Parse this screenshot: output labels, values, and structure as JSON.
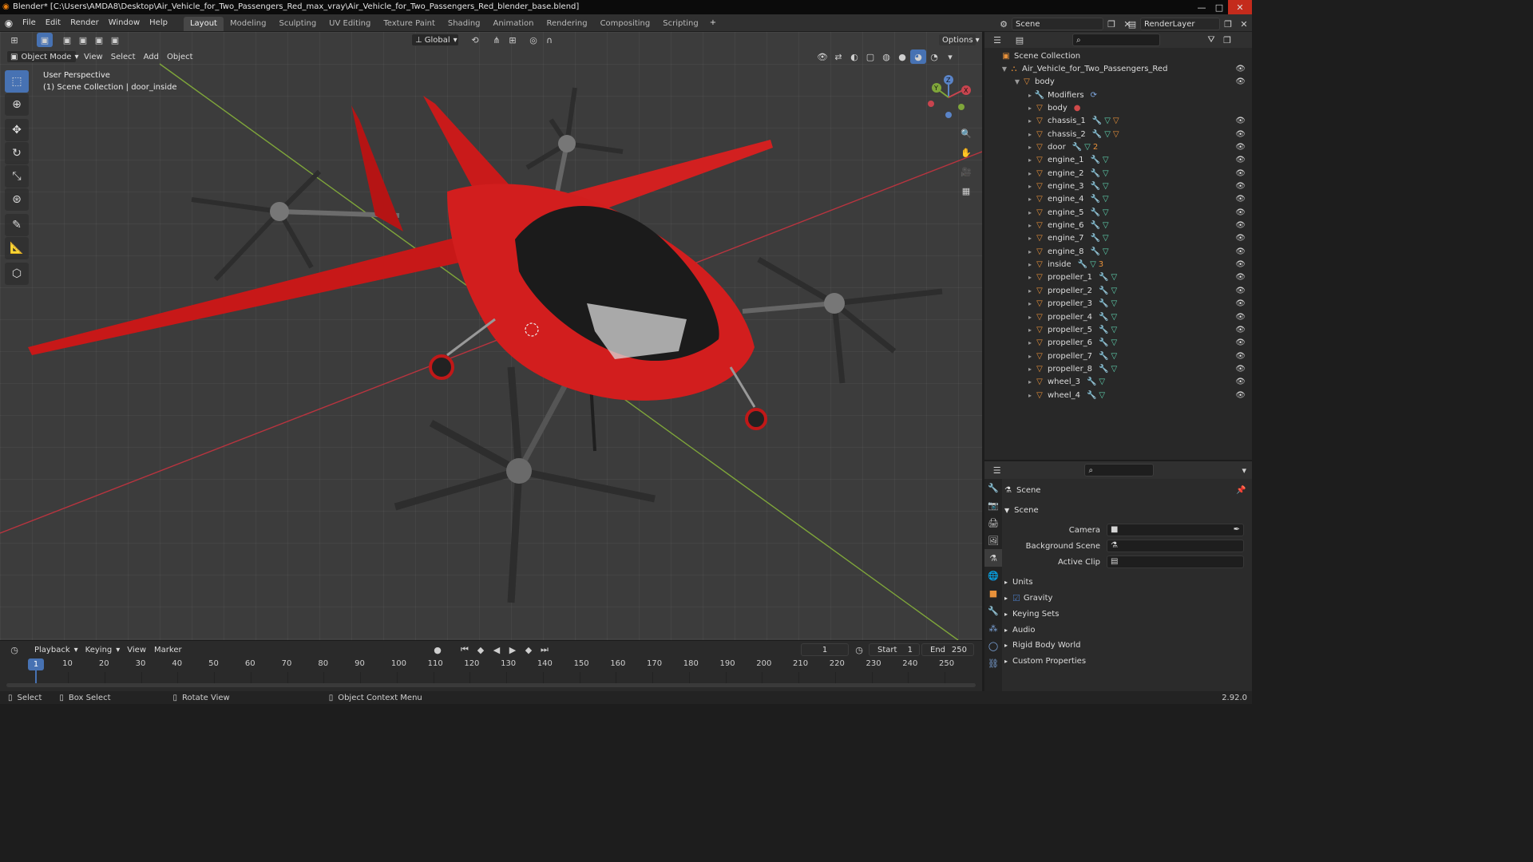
{
  "window": {
    "title": "Blender* [C:\\Users\\AMDA8\\Desktop\\Air_Vehicle_for_Two_Passengers_Red_max_vray\\Air_Vehicle_for_Two_Passengers_Red_blender_base.blend]",
    "minimize": "—",
    "maximize": "□",
    "close": "✕"
  },
  "menubar": {
    "items": [
      "File",
      "Edit",
      "Render",
      "Window",
      "Help"
    ],
    "workspaces": [
      "Layout",
      "Modeling",
      "Sculpting",
      "UV Editing",
      "Texture Paint",
      "Shading",
      "Animation",
      "Rendering",
      "Compositing",
      "Scripting"
    ],
    "active_workspace": "Layout",
    "add_workspace": "+",
    "scene_name": "Scene",
    "render_layer": "RenderLayer"
  },
  "viewport": {
    "mode": "Object Mode",
    "menus": [
      "View",
      "Select",
      "Add",
      "Object"
    ],
    "transform_orientation": "Global",
    "options_label": "Options",
    "perspective_label": "User Perspective",
    "collection_info": "(1) Scene Collection | door_inside",
    "gizmo_axes": {
      "x": "X",
      "y": "Y",
      "z": "Z"
    },
    "colors": {
      "body_red": "#d01e1e",
      "grid_bg": "#3c3c3c",
      "x_axis": "#b8343f",
      "y_axis": "#7fa63a"
    }
  },
  "outliner": {
    "root": "Scene Collection",
    "collection": "Air_Vehicle_for_Two_Passengers_Red",
    "parent": "body",
    "modifiers_label": "Modifiers",
    "body_mesh": "body",
    "children": [
      "chassis_1",
      "chassis_2",
      "door",
      "engine_1",
      "engine_2",
      "engine_3",
      "engine_4",
      "engine_5",
      "engine_6",
      "engine_7",
      "engine_8",
      "inside",
      "propeller_1",
      "propeller_2",
      "propeller_3",
      "propeller_4",
      "propeller_5",
      "propeller_6",
      "propeller_7",
      "propeller_8",
      "wheel_3",
      "wheel_4"
    ],
    "badge_door": "2",
    "badge_inside": "3"
  },
  "properties": {
    "context_title": "Scene",
    "panel_scene": "Scene",
    "camera_label": "Camera",
    "background_scene_label": "Background Scene",
    "active_clip_label": "Active Clip",
    "panels": [
      "Units",
      "Gravity",
      "Keying Sets",
      "Audio",
      "Rigid Body World",
      "Custom Properties"
    ],
    "gravity_checked": true,
    "version": "2.92.0"
  },
  "timeline": {
    "menus": [
      "Playback",
      "Keying",
      "View",
      "Marker"
    ],
    "current_frame": "1",
    "start_label": "Start",
    "start": "1",
    "end_label": "End",
    "end": "250",
    "ticks": [
      "10",
      "20",
      "30",
      "40",
      "50",
      "60",
      "70",
      "80",
      "90",
      "100",
      "110",
      "120",
      "130",
      "140",
      "150",
      "160",
      "170",
      "180",
      "190",
      "200",
      "210",
      "220",
      "230",
      "240",
      "250"
    ],
    "playhead_frame": "1"
  },
  "statusbar": {
    "select": "Select",
    "box_select": "Box Select",
    "rotate_view": "Rotate View",
    "context_menu": "Object Context Menu"
  }
}
